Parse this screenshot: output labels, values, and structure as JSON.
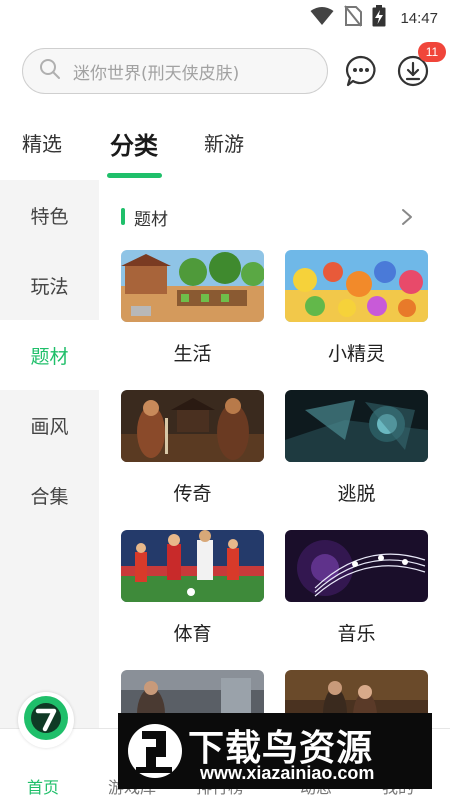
{
  "status_bar": {
    "time": "14:47"
  },
  "header": {
    "search_placeholder": "迷你世界(刑天侠皮肤)",
    "download_badge": "11"
  },
  "top_tabs": [
    {
      "label": "精选",
      "active": false
    },
    {
      "label": "分类",
      "active": true
    },
    {
      "label": "新游",
      "active": false
    }
  ],
  "sidebar": {
    "items": [
      {
        "label": "特色",
        "active": false
      },
      {
        "label": "玩法",
        "active": false
      },
      {
        "label": "题材",
        "active": true
      },
      {
        "label": "画风",
        "active": false
      },
      {
        "label": "合集",
        "active": false
      }
    ]
  },
  "section": {
    "title": "题材"
  },
  "categories": [
    {
      "label": "生活"
    },
    {
      "label": "小精灵"
    },
    {
      "label": "传奇"
    },
    {
      "label": "逃脱"
    },
    {
      "label": "体育"
    },
    {
      "label": "音乐"
    },
    {
      "label": ""
    },
    {
      "label": ""
    }
  ],
  "bottom_nav": {
    "items": [
      {
        "label": "首页",
        "active": true
      },
      {
        "label": "游戏库",
        "active": false
      },
      {
        "label": "排行榜",
        "active": false
      },
      {
        "label": "动态",
        "active": false
      },
      {
        "label": "我的",
        "active": false
      }
    ]
  },
  "watermark": {
    "title": "下载鸟资源",
    "url": "www.xiazainiao.com"
  },
  "colors": {
    "accent": "#1fbf6a",
    "badge": "#f0453a"
  }
}
